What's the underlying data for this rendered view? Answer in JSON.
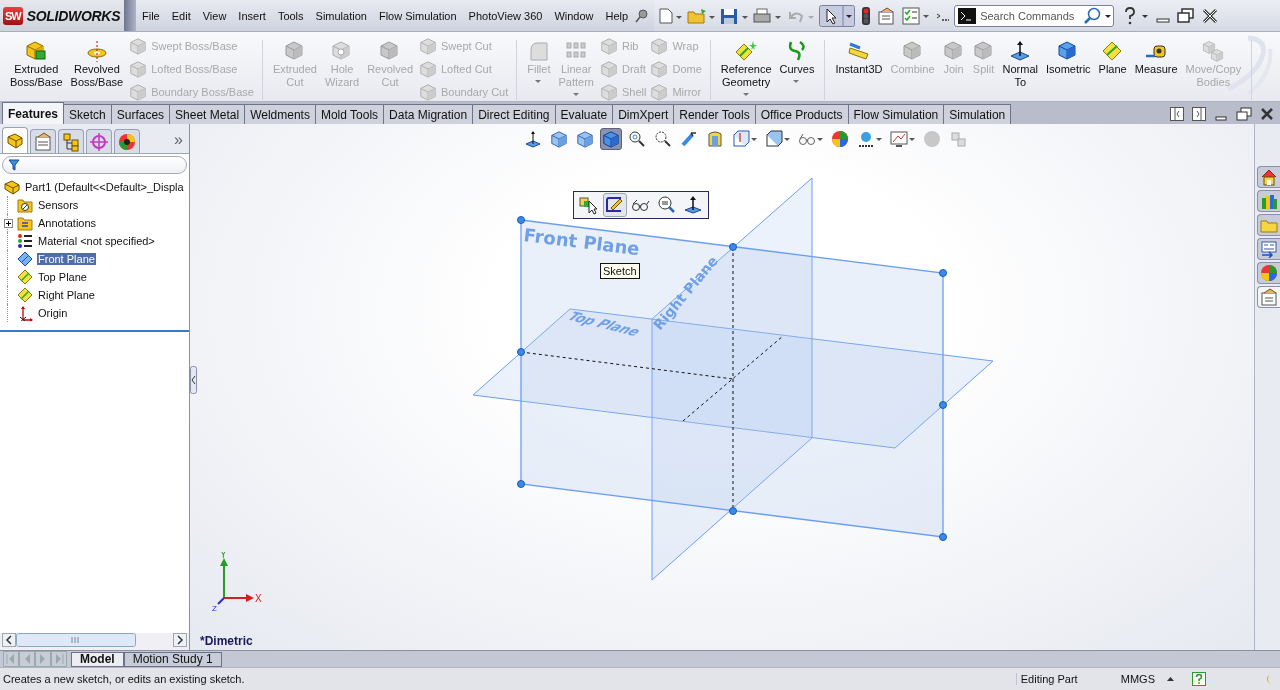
{
  "app": {
    "logo_mark": "SW",
    "logo": "SOLIDWORKS"
  },
  "menu": [
    "File",
    "Edit",
    "View",
    "Insert",
    "Tools",
    "Simulation",
    "Flow Simulation",
    "PhotoView 360",
    "Window",
    "Help"
  ],
  "search": {
    "placeholder": "Search Commands"
  },
  "ribbon": [
    {
      "items": [
        {
          "kind": "large",
          "label": "Extruded Boss/Base",
          "disabled": false,
          "dropdown": false
        },
        {
          "kind": "large",
          "label": "Revolved Boss/Base",
          "disabled": false,
          "dropdown": false
        },
        {
          "kind": "stack",
          "entries": [
            {
              "label": "Swept Boss/Base",
              "disabled": true
            },
            {
              "label": "Lofted Boss/Base",
              "disabled": true
            },
            {
              "label": "Boundary Boss/Base",
              "disabled": true
            }
          ]
        }
      ]
    },
    {
      "items": [
        {
          "kind": "large",
          "label": "Extruded Cut",
          "disabled": true,
          "dropdown": false
        },
        {
          "kind": "large",
          "label": "Hole Wizard",
          "disabled": true,
          "dropdown": false
        },
        {
          "kind": "large",
          "label": "Revolved Cut",
          "disabled": true,
          "dropdown": false
        },
        {
          "kind": "stack",
          "entries": [
            {
              "label": "Swept Cut",
              "disabled": true
            },
            {
              "label": "Lofted Cut",
              "disabled": true
            },
            {
              "label": "Boundary Cut",
              "disabled": true
            }
          ]
        }
      ]
    },
    {
      "items": [
        {
          "kind": "large",
          "label": "Fillet",
          "disabled": true,
          "dropdown": true
        },
        {
          "kind": "large",
          "label": "Linear Pattern",
          "disabled": true,
          "dropdown": true
        },
        {
          "kind": "stack",
          "entries": [
            {
              "label": "Rib",
              "disabled": true
            },
            {
              "label": "Draft",
              "disabled": true
            },
            {
              "label": "Shell",
              "disabled": true
            }
          ]
        },
        {
          "kind": "stack",
          "entries": [
            {
              "label": "Wrap",
              "disabled": true
            },
            {
              "label": "Dome",
              "disabled": true
            },
            {
              "label": "Mirror",
              "disabled": true
            }
          ]
        }
      ]
    },
    {
      "items": [
        {
          "kind": "large",
          "label": "Reference Geometry",
          "disabled": false,
          "dropdown": true
        },
        {
          "kind": "large",
          "label": "Curves",
          "disabled": false,
          "dropdown": true
        }
      ]
    },
    {
      "items": [
        {
          "kind": "large",
          "label": "Instant3D",
          "disabled": false,
          "dropdown": false
        },
        {
          "kind": "large",
          "label": "Combine",
          "disabled": true,
          "dropdown": false
        },
        {
          "kind": "large",
          "label": "Join",
          "disabled": true,
          "dropdown": false
        },
        {
          "kind": "large",
          "label": "Split",
          "disabled": true,
          "dropdown": false
        },
        {
          "kind": "large",
          "label": "Normal To",
          "disabled": false,
          "dropdown": false
        },
        {
          "kind": "large",
          "label": "Isometric",
          "disabled": false,
          "dropdown": false
        },
        {
          "kind": "large",
          "label": "Plane",
          "disabled": false,
          "dropdown": false
        },
        {
          "kind": "large",
          "label": "Measure",
          "disabled": false,
          "dropdown": false
        },
        {
          "kind": "large",
          "label": "Move/Copy Bodies",
          "disabled": true,
          "dropdown": false
        }
      ]
    }
  ],
  "tabs": [
    {
      "label": "Features",
      "selected": true
    },
    {
      "label": "Sketch",
      "selected": false
    },
    {
      "label": "Surfaces",
      "selected": false
    },
    {
      "label": "Sheet Metal",
      "selected": false
    },
    {
      "label": "Weldments",
      "selected": false
    },
    {
      "label": "Mold Tools",
      "selected": false
    },
    {
      "label": "Data Migration",
      "selected": false
    },
    {
      "label": "Direct Editing",
      "selected": false
    },
    {
      "label": "Evaluate",
      "selected": false
    },
    {
      "label": "DimXpert",
      "selected": false
    },
    {
      "label": "Render Tools",
      "selected": false
    },
    {
      "label": "Office Products",
      "selected": false
    },
    {
      "label": "Flow Simulation",
      "selected": false
    },
    {
      "label": "Simulation",
      "selected": false
    }
  ],
  "panel": {
    "tabs": [
      {
        "selected": true
      },
      {
        "selected": false
      },
      {
        "selected": false
      },
      {
        "selected": false
      },
      {
        "selected": false
      }
    ],
    "more": "»"
  },
  "tree": {
    "label": "Part1  (Default<<Default>_Displa",
    "selected": false,
    "children": [
      {
        "label": "Sensors",
        "selected": false
      },
      {
        "label": "Annotations",
        "selected": false,
        "expanded": false
      },
      {
        "label": "Material <not specified>",
        "selected": false
      },
      {
        "label": "Front Plane",
        "selected": true
      },
      {
        "label": "Top Plane",
        "selected": false
      },
      {
        "label": "Right Plane",
        "selected": false
      },
      {
        "label": "Origin",
        "selected": false
      }
    ]
  },
  "view_tools": [
    {
      "selected": false,
      "dropdown": false
    },
    {
      "selected": false,
      "dropdown": false
    },
    {
      "selected": false,
      "dropdown": false
    },
    {
      "selected": true,
      "dropdown": false
    },
    {
      "selected": false,
      "dropdown": false
    },
    {
      "selected": false,
      "dropdown": false
    },
    {
      "selected": false,
      "dropdown": false
    },
    {
      "selected": false,
      "dropdown": false
    },
    {
      "selected": false,
      "dropdown": true
    },
    {
      "selected": false,
      "dropdown": true
    },
    {
      "selected": false,
      "dropdown": true
    },
    {
      "selected": false,
      "dropdown": false
    },
    {
      "selected": false,
      "dropdown": true
    },
    {
      "selected": false,
      "dropdown": true
    },
    {
      "selected": false,
      "dropdown": false
    },
    {
      "selected": false,
      "dropdown": false
    }
  ],
  "context_toolbar": [
    {
      "selected": false
    },
    {
      "selected": true
    },
    {
      "selected": false
    },
    {
      "selected": false
    },
    {
      "selected": false
    }
  ],
  "tooltip": "Sketch",
  "planes": [
    {
      "kind": "front",
      "label": "Front Plane"
    },
    {
      "kind": "top",
      "label": "Top Plane"
    },
    {
      "kind": "right",
      "label": "Right Plane"
    }
  ],
  "triad": {
    "x": "X",
    "y": "Y",
    "z": "Z"
  },
  "view_name": "*Dimetric",
  "task_pane": [
    {
      "selected": false
    },
    {
      "selected": false
    },
    {
      "selected": false
    },
    {
      "selected": false
    },
    {
      "selected": false
    },
    {
      "selected": true
    }
  ],
  "bottom_tabs": [
    {
      "label": "Model",
      "selected": true
    },
    {
      "label": "Motion Study 1",
      "selected": false
    }
  ],
  "status_bar": {
    "message": "Creates a new sketch, or edits an existing sketch.",
    "mode": "Editing Part",
    "units": "MMGS"
  }
}
